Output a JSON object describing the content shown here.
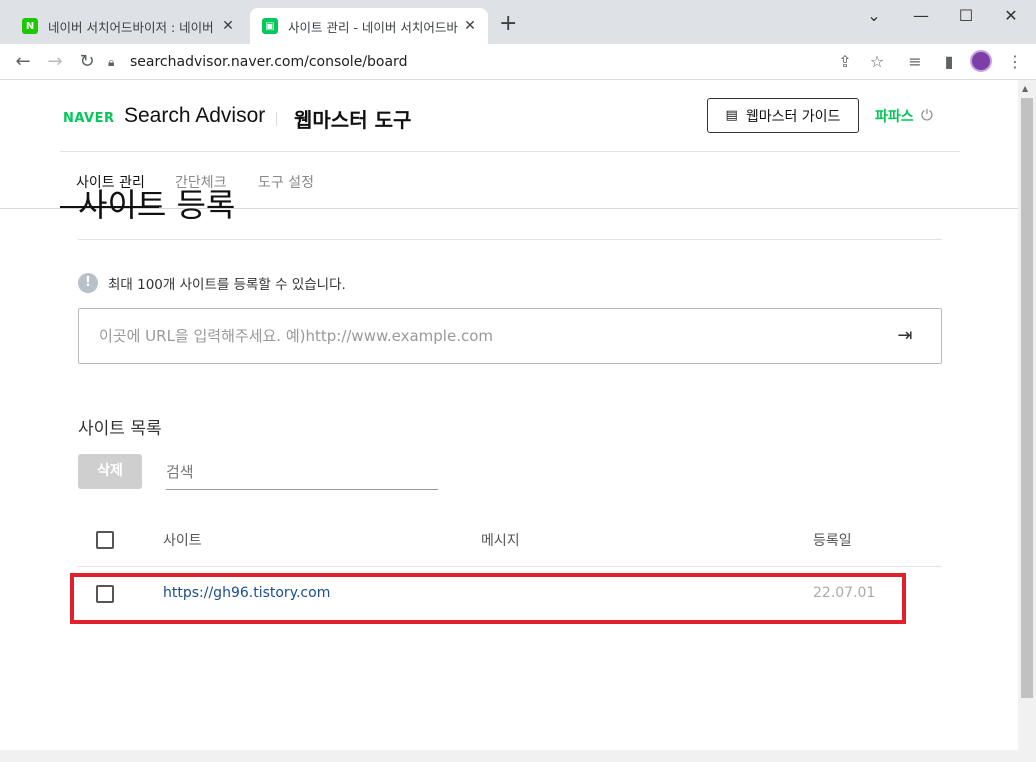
{
  "browser": {
    "tabs": [
      {
        "title": "네이버 서치어드바이저 : 네이버",
        "favicon": "N",
        "favicon_color": "#1ec800",
        "active": false
      },
      {
        "title": "사이트 관리 - 네이버 서치어드바",
        "favicon": "▣",
        "favicon_color": "#03c75a",
        "active": true
      }
    ],
    "new_tab": "+",
    "url": "searchadvisor.naver.com/console/board"
  },
  "header": {
    "naver_logo": "NAVER",
    "brand": "Search Advisor",
    "sub_brand": "웹마스터 도구",
    "guide_button": "웹마스터 가이드",
    "user": "파파스"
  },
  "nav_tabs": [
    {
      "label": "사이트 관리",
      "active": true
    },
    {
      "label": "간단체크",
      "active": false
    },
    {
      "label": "도구 설정",
      "active": false
    }
  ],
  "main": {
    "heading": "사이트 등록",
    "notice": "최대 100개 사이트를 등록할 수 있습니다.",
    "url_placeholder": "이곳에 URL을 입력해주세요. 예)http://www.example.com",
    "list_title": "사이트 목록",
    "delete_button": "삭제",
    "search_placeholder": "검색",
    "columns": {
      "site": "사이트",
      "message": "메시지",
      "date": "등록일"
    },
    "rows": [
      {
        "site": "https://gh96.tistory.com",
        "message": "",
        "date": "22.07.01"
      }
    ]
  },
  "colors": {
    "naver_green": "#03c75a",
    "highlight": "#e0212b",
    "link": "#1a4d8f"
  }
}
